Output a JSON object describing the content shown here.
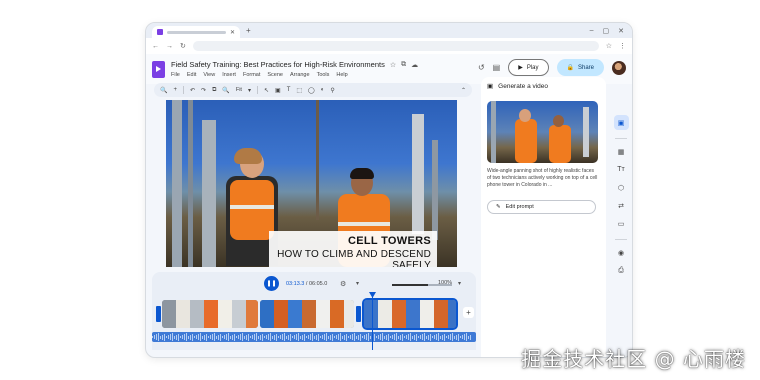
{
  "browser": {
    "window_controls": [
      "–",
      "▢",
      "✕"
    ],
    "tab_close": "✕",
    "new_tab": "+"
  },
  "nav": {
    "back": "←",
    "forward": "→",
    "reload": "↻",
    "bookmark": "☆",
    "more": "⋮"
  },
  "doc": {
    "title": "Field Safety Training: Best Practices for High-Risk Environments",
    "star": "☆",
    "move": "⧉",
    "cloud": "☁",
    "menu": [
      "File",
      "Edit",
      "View",
      "Insert",
      "Format",
      "Scene",
      "Arrange",
      "Tools",
      "Help"
    ]
  },
  "appbar": {
    "history": "↺",
    "comment": "▤",
    "play_label": "Play",
    "play_icon": "▶",
    "share_label": "Share",
    "share_icon": "🔒"
  },
  "toolbar": {
    "items": [
      "🔍",
      "+",
      "↶",
      "↷",
      "⧉",
      "🔍",
      "Fit",
      "▾",
      "↖",
      "▣",
      "T",
      "⬚",
      "◯",
      "◐",
      "⚲"
    ],
    "collapse": "⌃"
  },
  "caption": {
    "title": "CELL TOWERS",
    "subtitle": "HOW TO CLIMB AND DESCEND SAFELY"
  },
  "timeline": {
    "pause_icon": "❚❚",
    "current_time": "03:13.3",
    "separator": " / ",
    "total_time": "06:05.0",
    "speed_icon": "⚙",
    "speed_chevron": "▾",
    "zoom_level": "100%",
    "zoom_chevron": "▾",
    "zoom_fill": 0.6,
    "add": "+"
  },
  "side_panel": {
    "header_icon": "▣",
    "header": "Generate a video",
    "description": "Wide-angle panning shot of highly realistic faces of two technicians actively working on top of a cell phone tower in Colorado in ...",
    "edit_icon": "✎",
    "edit_label": "Edit prompt"
  },
  "rail": [
    "▣",
    "▦",
    "Tт",
    "⬡",
    "⇄",
    "▭",
    "◉",
    "⎙"
  ],
  "watermark": "掘金技术社区 @ 心雨楼"
}
